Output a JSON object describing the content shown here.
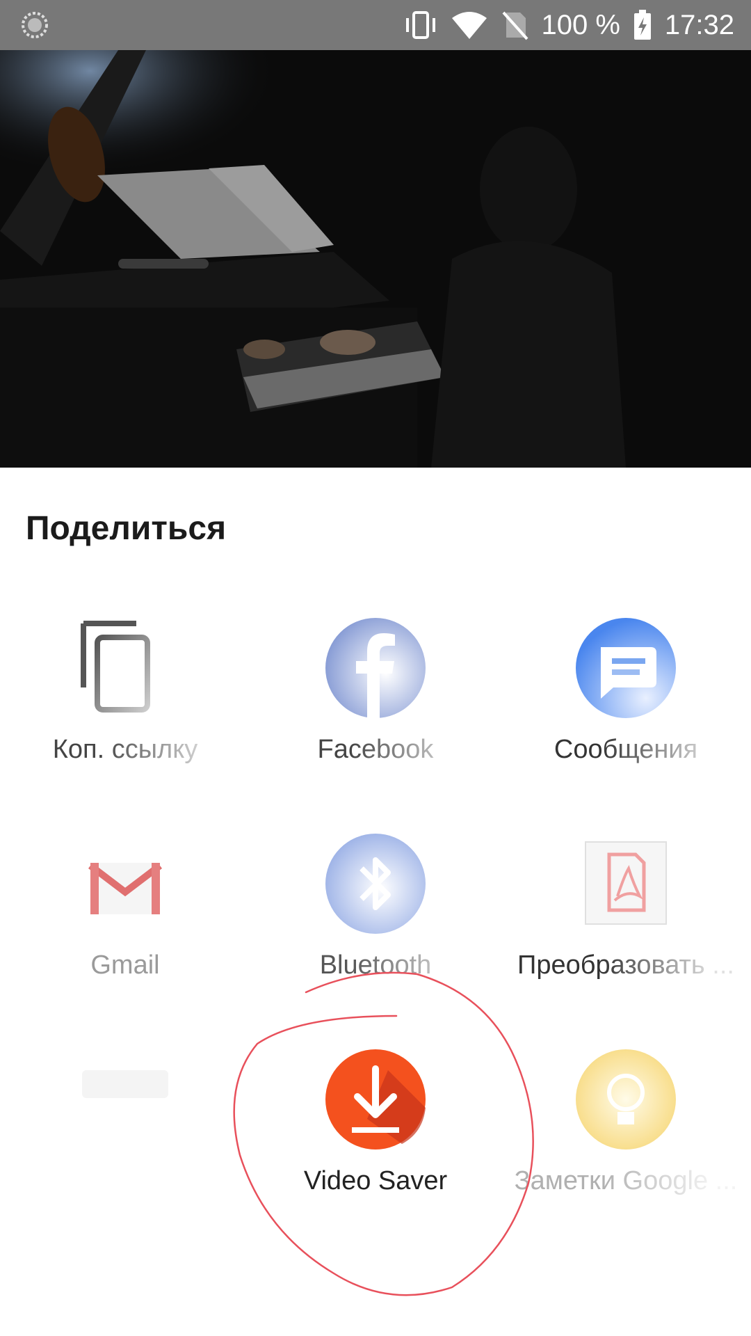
{
  "status_bar": {
    "battery_percent": "100 %",
    "time": "17:32",
    "icons": [
      "sync-icon",
      "vibrate-icon",
      "wifi-icon",
      "no-sim-icon",
      "battery-charging-icon"
    ]
  },
  "video": {
    "description_icon": "video-thumbnail"
  },
  "share": {
    "title": "Поделиться",
    "items": [
      {
        "label": "Коп. ссылку",
        "icon": "copy-link-icon",
        "color": "#555555"
      },
      {
        "label": "Facebook",
        "icon": "facebook-icon",
        "color": "#3b5998"
      },
      {
        "label": "Сообщения",
        "icon": "messages-icon",
        "color": "#4285f4"
      },
      {
        "label": "Gmail",
        "icon": "gmail-icon",
        "color": "#ea4335"
      },
      {
        "label": "Bluetooth",
        "icon": "bluetooth-icon",
        "color": "#7f9be0"
      },
      {
        "label": "Преобразовать ...",
        "icon": "pdf-convert-icon",
        "color": "#e57373"
      },
      {
        "label": "",
        "icon": "blank-icon",
        "color": "#eeeeee"
      },
      {
        "label": "Video Saver",
        "icon": "video-saver-icon",
        "color": "#f4511e"
      },
      {
        "label": "Заметки Google ...",
        "icon": "keep-notes-icon",
        "color": "#fbbc04"
      }
    ]
  },
  "annotation": {
    "color": "#e8505b"
  }
}
